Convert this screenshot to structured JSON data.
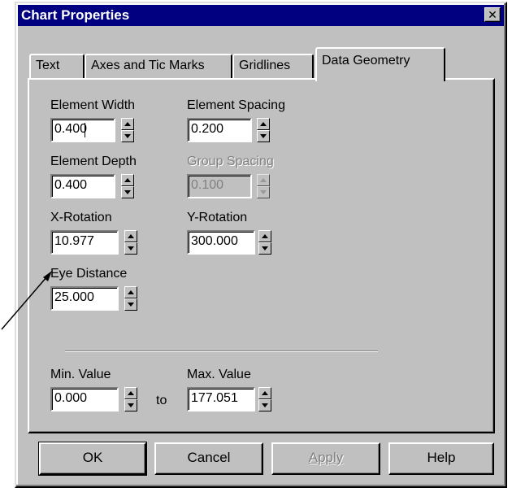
{
  "window": {
    "title": "Chart Properties",
    "close_glyph": "✕"
  },
  "tabs": [
    {
      "label": "Text"
    },
    {
      "label": "Axes and Tic Marks"
    },
    {
      "label": "Gridlines"
    },
    {
      "label": "Data Geometry",
      "active": true
    }
  ],
  "fields": {
    "element_width": {
      "label": "Element Width",
      "value": "0.400"
    },
    "element_spacing": {
      "label": "Element Spacing",
      "value": "0.200"
    },
    "element_depth": {
      "label": "Element Depth",
      "value": "0.400"
    },
    "group_spacing": {
      "label": "Group Spacing",
      "value": "0.100",
      "disabled": true
    },
    "x_rotation": {
      "label": "X-Rotation",
      "value": "10.977"
    },
    "y_rotation": {
      "label": "Y-Rotation",
      "value": "300.000"
    },
    "eye_distance": {
      "label": "Eye Distance",
      "value": "25.000"
    },
    "min_value": {
      "label": "Min. Value",
      "value": "0.000"
    },
    "max_value": {
      "label": "Max. Value",
      "value": "177.051"
    }
  },
  "range_separator": "to",
  "buttons": {
    "ok": "OK",
    "cancel": "Cancel",
    "apply": "Apply",
    "help": "Help"
  },
  "colors": {
    "titlebar": "#000080",
    "face": "#c0c0c0"
  }
}
